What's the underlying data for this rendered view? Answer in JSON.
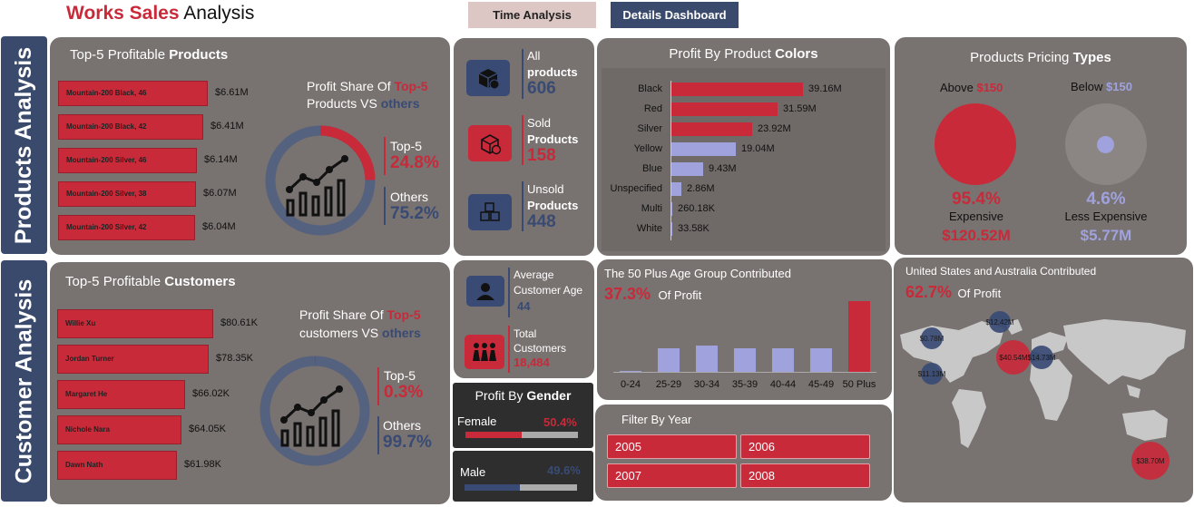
{
  "header": {
    "title_red": "Works Sales",
    "title_rest": " Analysis"
  },
  "nav": {
    "time_analysis": "Time Analysis",
    "details_dashboard": "Details Dashboard"
  },
  "sidebar": {
    "products": "Products Analysis",
    "customers": "Customer Analysis"
  },
  "top_products": {
    "title_pre": "Top-5 Profitable ",
    "title_bold": "Products",
    "items": [
      {
        "name": "Mountain-200 Black, 46",
        "value": "$6.61M",
        "amount": 6.61
      },
      {
        "name": "Mountain-200 Black, 42",
        "value": "$6.41M",
        "amount": 6.41
      },
      {
        "name": "Mountain-200 Silver, 46",
        "value": "$6.14M",
        "amount": 6.14
      },
      {
        "name": "Mountain-200 Silver, 38",
        "value": "$6.07M",
        "amount": 6.07
      },
      {
        "name": "Mountain-200 Silver, 42",
        "value": "$6.04M",
        "amount": 6.04
      }
    ],
    "share_line1": "Profit Share Of ",
    "share_top5": "Top-5",
    "share_line2": "Products VS ",
    "share_others": "others",
    "top5_label": "Top-5",
    "top5_pct": "24.8%",
    "top5_fraction": 0.248,
    "others_label": "Others",
    "others_pct": "75.2%"
  },
  "kpi_products": {
    "all_l1": "All",
    "all_l2": "products",
    "all_val": "606",
    "sold_l1": "Sold",
    "sold_l2": "Products",
    "sold_val": "158",
    "unsold_l1": "Unsold",
    "unsold_l2": "Products",
    "unsold_val": "448"
  },
  "colors_chart": {
    "title_pre": "Profit By Product ",
    "title_bold": "Colors",
    "items": [
      {
        "name": "Black",
        "label": "39.16M",
        "value": 39.16,
        "highlight": true
      },
      {
        "name": "Red",
        "label": "31.59M",
        "value": 31.59,
        "highlight": true
      },
      {
        "name": "Silver",
        "label": "23.92M",
        "value": 23.92,
        "highlight": true
      },
      {
        "name": "Yellow",
        "label": "19.04M",
        "value": 19.04,
        "highlight": false
      },
      {
        "name": "Blue",
        "label": "9.43M",
        "value": 9.43,
        "highlight": false
      },
      {
        "name": "Unspecified",
        "label": "2.86M",
        "value": 2.86,
        "highlight": false
      },
      {
        "name": "Multi",
        "label": "260.18K",
        "value": 0.26,
        "highlight": false
      },
      {
        "name": "White",
        "label": "33.58K",
        "value": 0.03,
        "highlight": false
      }
    ]
  },
  "pricing": {
    "title_pre": "Products Pricing ",
    "title_bold": "Types",
    "above_label": "Above ",
    "above_val": "$150",
    "below_label": "Below ",
    "below_val": "$150",
    "above_pct": "95.4%",
    "above_name": "Expensive",
    "above_amount": "$120.52M",
    "below_pct": "4.6%",
    "below_name": "Less Expensive",
    "below_amount": "$5.77M"
  },
  "top_customers": {
    "title_pre": "Top-5 Profitable ",
    "title_bold": "Customers",
    "items": [
      {
        "name": "Willie Xu",
        "value": "$80.61K",
        "amount": 80.61
      },
      {
        "name": "Jordan Turner",
        "value": "$78.35K",
        "amount": 78.35
      },
      {
        "name": "Margaret He",
        "value": "$66.02K",
        "amount": 66.02
      },
      {
        "name": "Nichole Nara",
        "value": "$64.05K",
        "amount": 64.05
      },
      {
        "name": "Dawn Nath",
        "value": "$61.98K",
        "amount": 61.98
      }
    ],
    "share_line1": "Profit Share Of ",
    "share_top5": "Top-5",
    "share_line2": "customers VS ",
    "share_others": "others",
    "top5_label": "Top-5",
    "top5_pct": "0.3%",
    "top5_fraction": 0.003,
    "others_label": "Others",
    "others_pct": "99.7%"
  },
  "kpi_customers": {
    "age_l1": "Average",
    "age_l2": "Customer Age",
    "age_val": "44",
    "total_l1": "Total",
    "total_l2": "Customers",
    "total_val": "18,484"
  },
  "gender": {
    "title_pre": "Profit By ",
    "title_bold": "Gender",
    "female": "Female",
    "female_pct": "50.4%",
    "female_fraction": 0.504,
    "male": "Male",
    "male_pct": "49.6%",
    "male_fraction": 0.496
  },
  "age_chart": {
    "title": "The 50 Plus Age Group Contributed",
    "pct": "37.3%",
    "pct_suffix": "Of Profit",
    "categories": [
      "0-24",
      "25-29",
      "30-34",
      "35-39",
      "40-44",
      "45-49",
      "50 Plus"
    ],
    "values": [
      1,
      25,
      28,
      25,
      25,
      25,
      75
    ]
  },
  "year_filter": {
    "title": "Filter By Year",
    "years": [
      "2005",
      "2006",
      "2007",
      "2008"
    ]
  },
  "map": {
    "title": "United States and Australia Contributed",
    "pct": "62.7%",
    "pct_suffix": "Of Profit",
    "bubbles": [
      "$12.42M",
      "$0.78M",
      "$40.54M",
      "$14.73M",
      "$11.13M",
      "$38.70M"
    ]
  }
}
